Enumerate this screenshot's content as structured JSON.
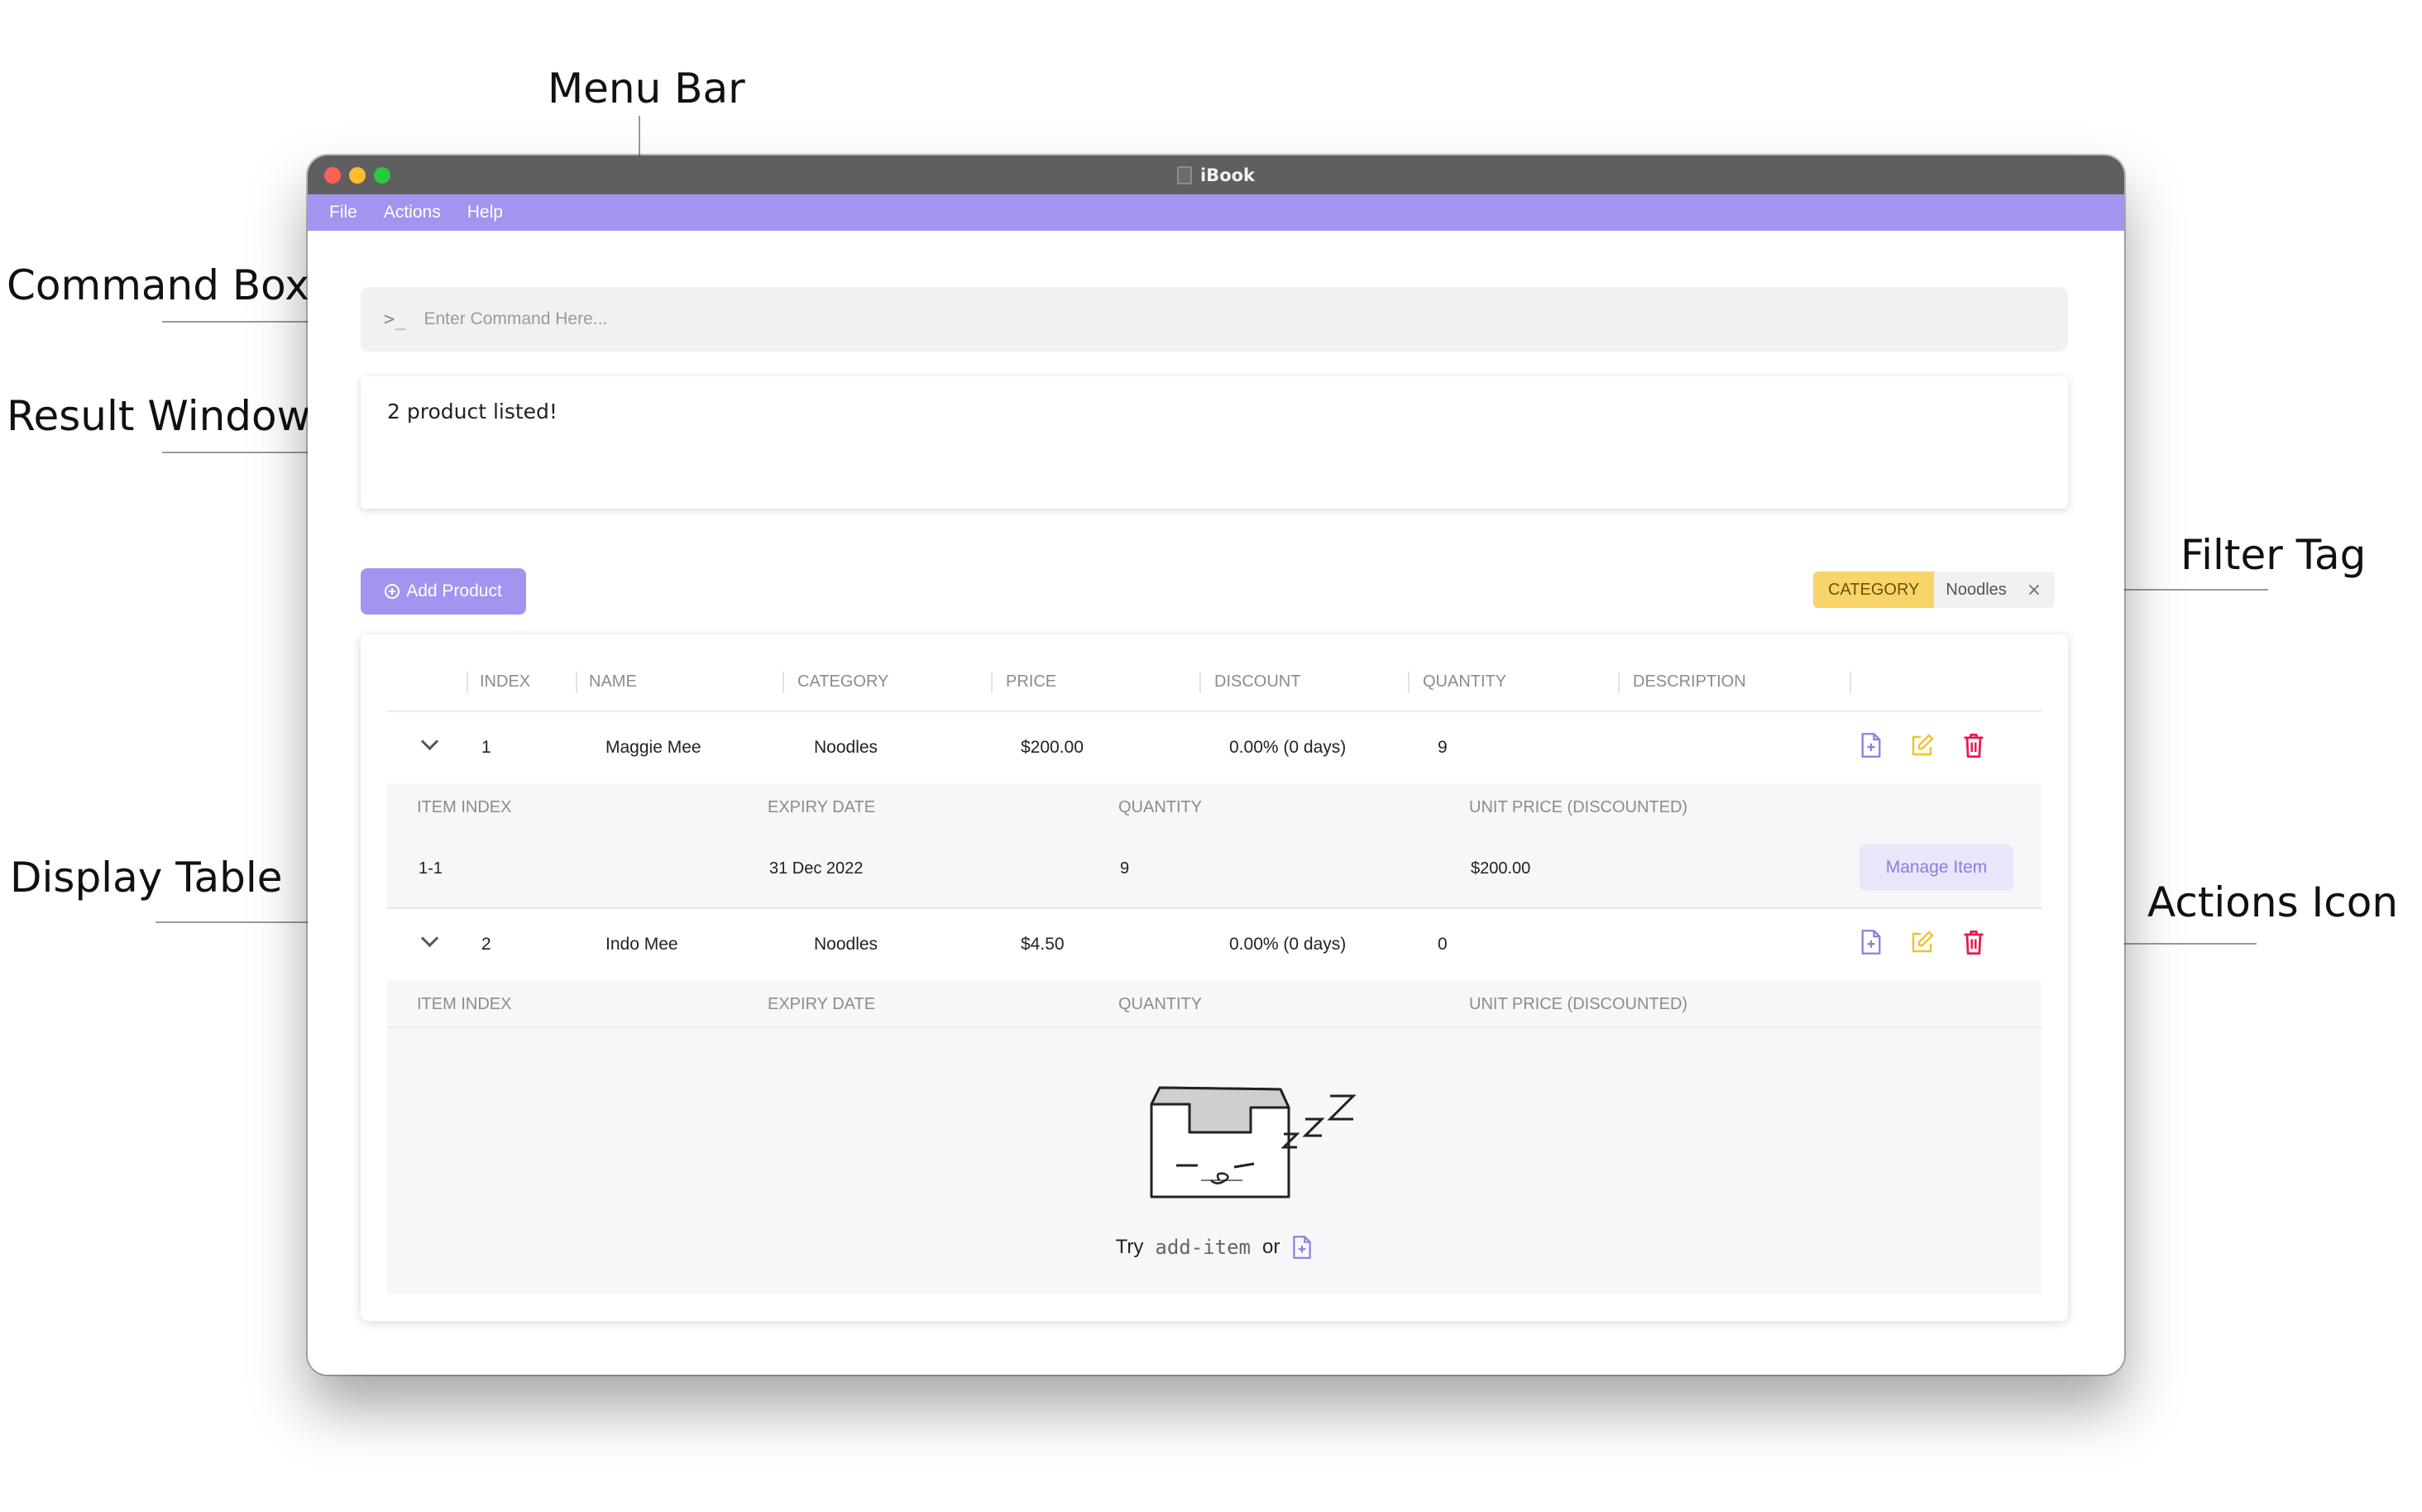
{
  "annotations": {
    "menu_bar": "Menu Bar",
    "command_box": "Command Box",
    "result_window": "Result Window",
    "filter_tag": "Filter Tag",
    "display_table": "Display Table",
    "actions_icon": "Actions Icon"
  },
  "window": {
    "title": "iBook"
  },
  "menu": {
    "items": [
      "File",
      "Actions",
      "Help"
    ]
  },
  "command": {
    "prompt": ">_",
    "placeholder": "Enter Command Here..."
  },
  "result": {
    "text": "2 product listed!"
  },
  "toolbar": {
    "add_product_label": "Add Product"
  },
  "filter": {
    "key": "CATEGORY",
    "value": "Noodles",
    "close_glyph": "×"
  },
  "table": {
    "columns": [
      "INDEX",
      "NAME",
      "CATEGORY",
      "PRICE",
      "DISCOUNT",
      "QUANTITY",
      "DESCRIPTION"
    ],
    "item_columns": [
      "ITEM INDEX",
      "EXPIRY DATE",
      "QUANTITY",
      "UNIT PRICE (DISCOUNTED)"
    ],
    "products": [
      {
        "index": "1",
        "name": "Maggie Mee",
        "category": "Noodles",
        "price": "$200.00",
        "discount": "0.00% (0 days)",
        "quantity": "9",
        "description": "",
        "items": [
          {
            "item_index": "1-1",
            "expiry": "31 Dec 2022",
            "quantity": "9",
            "unit_price": "$200.00",
            "action": "Manage Item"
          }
        ]
      },
      {
        "index": "2",
        "name": "Indo Mee",
        "category": "Noodles",
        "price": "$4.50",
        "discount": "0.00% (0 days)",
        "quantity": "0",
        "description": "",
        "items": []
      }
    ],
    "empty_state": {
      "try": "Try",
      "command": "add-item",
      "or": "or"
    }
  },
  "colors": {
    "accent": "#a195f0",
    "filter_key": "#f9d46b",
    "edit_icon": "#f2c12e",
    "delete_icon": "#e5194e",
    "add_icon": "#8a7ee0"
  },
  "icons": {
    "add_item": "file-plus-icon",
    "edit": "edit-icon",
    "delete": "trash-icon",
    "expand": "chevron-down-icon"
  }
}
